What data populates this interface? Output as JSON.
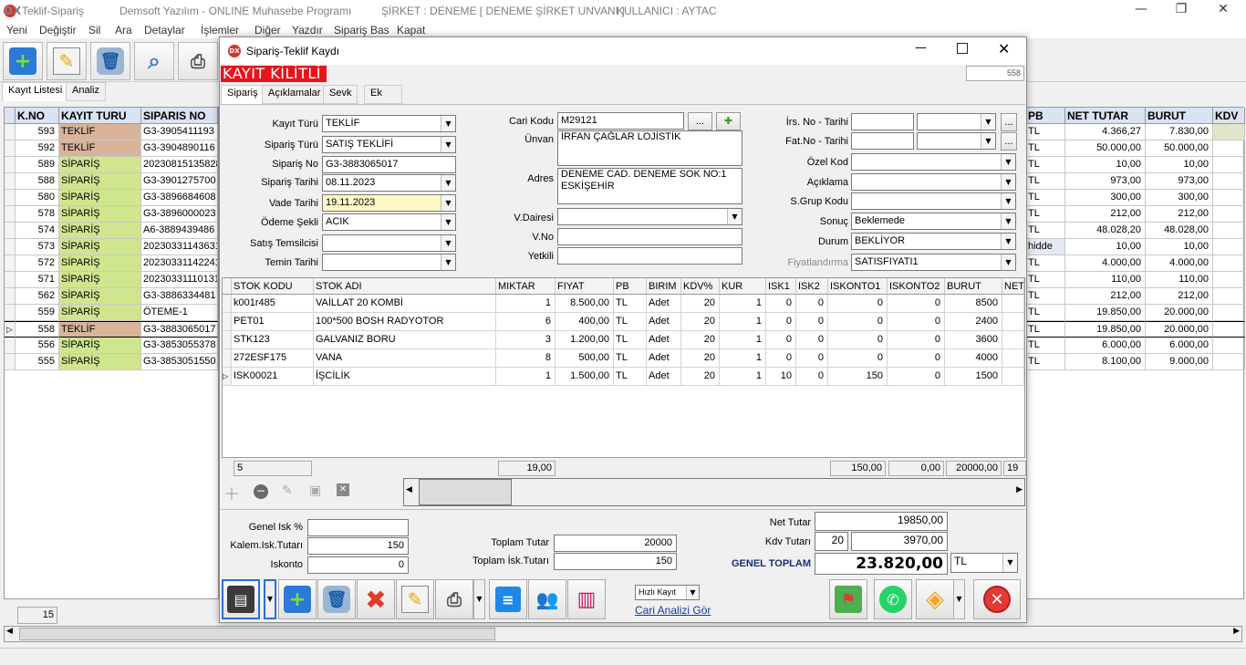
{
  "window": {
    "app_title": "Teklif-Sipariş",
    "vendor": "Demsoft Yazılım - ONLINE Muhasebe Programı",
    "company": "ŞİRKET : DENEME [ DENEME ŞİRKET UNVANI ]",
    "user": "KULLANICI : AYTAC",
    "logo_text": "DX",
    "minimize": "—",
    "maximize": "❐",
    "close": "✕"
  },
  "menu": [
    "Yeni",
    "Değiştir",
    "Sil",
    "Ara",
    "Detaylar",
    "İşlemler",
    "Diğer",
    "Yazdır",
    "Sipariş Bas",
    "Kapat"
  ],
  "main_tabs": [
    "Kayıt Listesi",
    "Analiz"
  ],
  "left_grid": {
    "headers": [
      "K.NO",
      "KAYIT TURU",
      "SIPARIS NO"
    ],
    "rows": [
      {
        "kno": "593",
        "tur": "TEKLİF",
        "no": "G3-3905411193"
      },
      {
        "kno": "592",
        "tur": "TEKLİF",
        "no": "G3-3904890116"
      },
      {
        "kno": "589",
        "tur": "SİPARİŞ",
        "no": "20230815135828"
      },
      {
        "kno": "588",
        "tur": "SİPARİŞ",
        "no": "G3-3901275700"
      },
      {
        "kno": "580",
        "tur": "SİPARİŞ",
        "no": "G3-3896684608"
      },
      {
        "kno": "578",
        "tur": "SİPARİŞ",
        "no": "G3-3896000023"
      },
      {
        "kno": "574",
        "tur": "SİPARİŞ",
        "no": "A6-3889439486"
      },
      {
        "kno": "573",
        "tur": "SİPARİŞ",
        "no": "20230331143631"
      },
      {
        "kno": "572",
        "tur": "SİPARİŞ",
        "no": "20230331142241"
      },
      {
        "kno": "571",
        "tur": "SİPARİŞ",
        "no": "20230331110131"
      },
      {
        "kno": "562",
        "tur": "SİPARİŞ",
        "no": "G3-3886334481"
      },
      {
        "kno": "559",
        "tur": "SİPARİŞ",
        "no": "ÖTEME-1"
      },
      {
        "kno": "558",
        "tur": "TEKLİF",
        "no": "G3-3883065017"
      },
      {
        "kno": "556",
        "tur": "SİPARİŞ",
        "no": "G3-3853055378"
      },
      {
        "kno": "555",
        "tur": "SİPARİŞ",
        "no": "G3-3853051550"
      }
    ],
    "count": "15",
    "selected_marker": "▷"
  },
  "right_grid": {
    "headers": [
      "PB",
      "NET TUTAR",
      "BURUT",
      "KDV"
    ],
    "rows": [
      {
        "pb": "TL",
        "net": "4.366,27",
        "burut": "7.830,00"
      },
      {
        "pb": "TL",
        "net": "50.000,00",
        "burut": "50.000,00"
      },
      {
        "pb": "TL",
        "net": "10,00",
        "burut": "10,00"
      },
      {
        "pb": "TL",
        "net": "973,00",
        "burut": "973,00"
      },
      {
        "pb": "TL",
        "net": "300,00",
        "burut": "300,00"
      },
      {
        "pb": "TL",
        "net": "212,00",
        "burut": "212,00"
      },
      {
        "pb": "TL",
        "net": "48.028,20",
        "burut": "48.028,00"
      },
      {
        "pb": "hidde",
        "net": "10,00",
        "burut": "10,00"
      },
      {
        "pb": "TL",
        "net": "4.000,00",
        "burut": "4.000,00"
      },
      {
        "pb": "TL",
        "net": "110,00",
        "burut": "110,00"
      },
      {
        "pb": "TL",
        "net": "212,00",
        "burut": "212,00"
      },
      {
        "pb": "TL",
        "net": "19.850,00",
        "burut": "20.000,00"
      },
      {
        "pb": "TL",
        "net": "19.850,00",
        "burut": "20.000,00"
      },
      {
        "pb": "TL",
        "net": "6.000,00",
        "burut": "6.000,00"
      },
      {
        "pb": "TL",
        "net": "8.100,00",
        "burut": "9.000,00"
      }
    ]
  },
  "dialog": {
    "title": "Sipariş-Teklif Kaydı",
    "locked": "KAYIT KİLİTLİ",
    "record_count": "558",
    "tabs": [
      "Sipariş",
      "Açıklamalar",
      "Sevk",
      "Ek"
    ],
    "left": {
      "kayit_turu": {
        "label": "Kayıt Türü",
        "value": "TEKLİF"
      },
      "siparis_turu": {
        "label": "Sipariş Türü",
        "value": "SATIŞ TEKLİFİ"
      },
      "siparis_no": {
        "label": "Sipariş No",
        "value": "G3-3883065017"
      },
      "siparis_tarihi": {
        "label": "Sipariş Tarihi",
        "value": "08.11.2023"
      },
      "vade_tarihi": {
        "label": "Vade Tarihi",
        "value": "19.11.2023"
      },
      "odeme_sekli": {
        "label": "Ödeme Şekli",
        "value": "ACIK"
      },
      "satis_temsilcisi": {
        "label": "Satış Temsilcisi",
        "value": ""
      },
      "temin_tarihi": {
        "label": "Temin Tarihi",
        "value": ""
      }
    },
    "mid": {
      "cari_kodu": {
        "label": "Cari Kodu",
        "value": "M29121"
      },
      "unvan": {
        "label": "Ünvan",
        "value": "İRFAN ÇAĞLAR LOJİSTİK"
      },
      "adres": {
        "label": "Adres",
        "line1": "DENEME CAD. DENEME SOK NO:1",
        "line2": "ESKİŞEHİR"
      },
      "vdairesi": {
        "label": "V.Dairesi",
        "value": ""
      },
      "vno": {
        "label": "V.No",
        "value": ""
      },
      "yetkili": {
        "label": "Yetkili",
        "value": ""
      },
      "browse": "..."
    },
    "right": {
      "irs": {
        "label": "İrs. No - Tarihi"
      },
      "fat": {
        "label": "Fat.No - Tarihi"
      },
      "ozel_kod": {
        "label": "Özel Kod",
        "value": ""
      },
      "aciklama": {
        "label": "Açıklama",
        "value": ""
      },
      "sgrup": {
        "label": "S.Grup Kodu",
        "value": ""
      },
      "sonuc": {
        "label": "Sonuç",
        "value": "Beklemede"
      },
      "durum": {
        "label": "Durum",
        "value": "BEKLİYOR"
      },
      "fiyatlandirma": {
        "label": "Fiyatlandırma",
        "value": "SATISFIYATI1"
      }
    },
    "grid": {
      "headers": [
        "STOK KODU",
        "STOK ADI",
        "MIKTAR",
        "FIYAT",
        "PB",
        "BIRIM",
        "KDV%",
        "KUR",
        "ISK1",
        "ISK2",
        "ISKONTO1",
        "ISKONTO2",
        "BURUT",
        "NET"
      ],
      "rows": [
        [
          "k001r485",
          "VAİLLAT 20 KOMBİ",
          "1",
          "8.500,00",
          "TL",
          "Adet",
          "20",
          "1",
          "0",
          "0",
          "0",
          "0",
          "8500"
        ],
        [
          "PET01",
          "100*500 BOSH RADYOTOR",
          "6",
          "400,00",
          "TL",
          "Adet",
          "20",
          "1",
          "0",
          "0",
          "0",
          "0",
          "2400"
        ],
        [
          "STK123",
          "GALVANIZ BORU",
          "3",
          "1.200,00",
          "TL",
          "Adet",
          "20",
          "1",
          "0",
          "0",
          "0",
          "0",
          "3600"
        ],
        [
          "272ESF175",
          "VANA",
          "8",
          "500,00",
          "TL",
          "Adet",
          "20",
          "1",
          "0",
          "0",
          "0",
          "0",
          "4000"
        ],
        [
          "ISK00021",
          "İŞCİLİK",
          "1",
          "1.500,00",
          "TL",
          "Adet",
          "20",
          "1",
          "10",
          "0",
          "150",
          "0",
          "1500"
        ]
      ],
      "footer": {
        "count": "5",
        "miktar": "19,00",
        "isk1": "150,00",
        "isk2": "0,00",
        "burut": "20000,00",
        "net": "19"
      }
    },
    "totals": {
      "genel_isk": {
        "label": "Genel Isk %",
        "value": ""
      },
      "kalem_isk": {
        "label": "Kalem.Isk.Tutarı",
        "value": "150"
      },
      "iskonto": {
        "label": "Iskonto",
        "value": "0"
      },
      "toplam_tutar": {
        "label": "Toplam Tutar",
        "value": "20000"
      },
      "toplam_isk": {
        "label": "Toplam İsk.Tutarı",
        "value": "150"
      },
      "net_tutar": {
        "label": "Net Tutar",
        "value": "19850,00"
      },
      "kdv_tutari": {
        "label": "Kdv Tutarı",
        "rate": "20",
        "value": "3970,00"
      },
      "genel_toplam": {
        "label": "GENEL TOPLAM",
        "value": "23.820,00",
        "currency": "TL"
      }
    },
    "bottom": {
      "hizli_kayit": "Hızlı Kayıt",
      "cari_analizi": "Cari Analizi Gör"
    }
  },
  "colors": {
    "teklif": "#d8b49a",
    "siparis": "#cfe58e",
    "locked_bg": "#e8141b",
    "header_bg": "#d9e3f2",
    "vade_bg": "#fff8c4"
  }
}
